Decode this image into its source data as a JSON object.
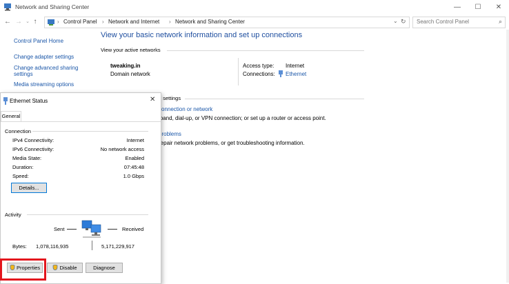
{
  "window": {
    "title": "Network and Sharing Center",
    "controls": {
      "minimize": "—",
      "maximize": "☐",
      "close": "✕"
    }
  },
  "addressbar": {
    "path": [
      "Control Panel",
      "Network and Internet",
      "Network and Sharing Center"
    ],
    "search_placeholder": "Search Control Panel"
  },
  "sidebar": {
    "home": "Control Panel Home",
    "links": [
      "Change adapter settings",
      "Change advanced sharing",
      "settings",
      "Media streaming options"
    ]
  },
  "main": {
    "heading": "View your basic network information and set up connections",
    "active_label": "View your active networks",
    "network_name": "tweaking.in",
    "network_type": "Domain network",
    "access_type_label": "Access type:",
    "access_type_value": "Internet",
    "connections_label": "Connections:",
    "connections_value": "Ethernet",
    "change_settings_fragment": "g settings",
    "setup_link_fragment": "connection or network",
    "setup_desc_fragment": "lband, dial-up, or VPN connection; or set up a router or access point.",
    "trouble_link_fragment": "problems",
    "trouble_desc_fragment": "repair network problems, or get troubleshooting information."
  },
  "dialog": {
    "title": "Ethernet Status",
    "tab": "General",
    "connection_group": "Connection",
    "rows": [
      {
        "label": "IPv4 Connectivity:",
        "value": "Internet"
      },
      {
        "label": "IPv6 Connectivity:",
        "value": "No network access"
      },
      {
        "label": "Media State:",
        "value": "Enabled"
      },
      {
        "label": "Duration:",
        "value": "07:45:48"
      },
      {
        "label": "Speed:",
        "value": "1.0 Gbps"
      }
    ],
    "details_button": "Details...",
    "activity_group": "Activity",
    "sent_label": "Sent",
    "received_label": "Received",
    "bytes_label": "Bytes:",
    "bytes_sent": "1,078,116,935",
    "bytes_received": "5,171,229,917",
    "buttons": {
      "properties": "Properties",
      "disable": "Disable",
      "diagnose": "Diagnose"
    }
  }
}
